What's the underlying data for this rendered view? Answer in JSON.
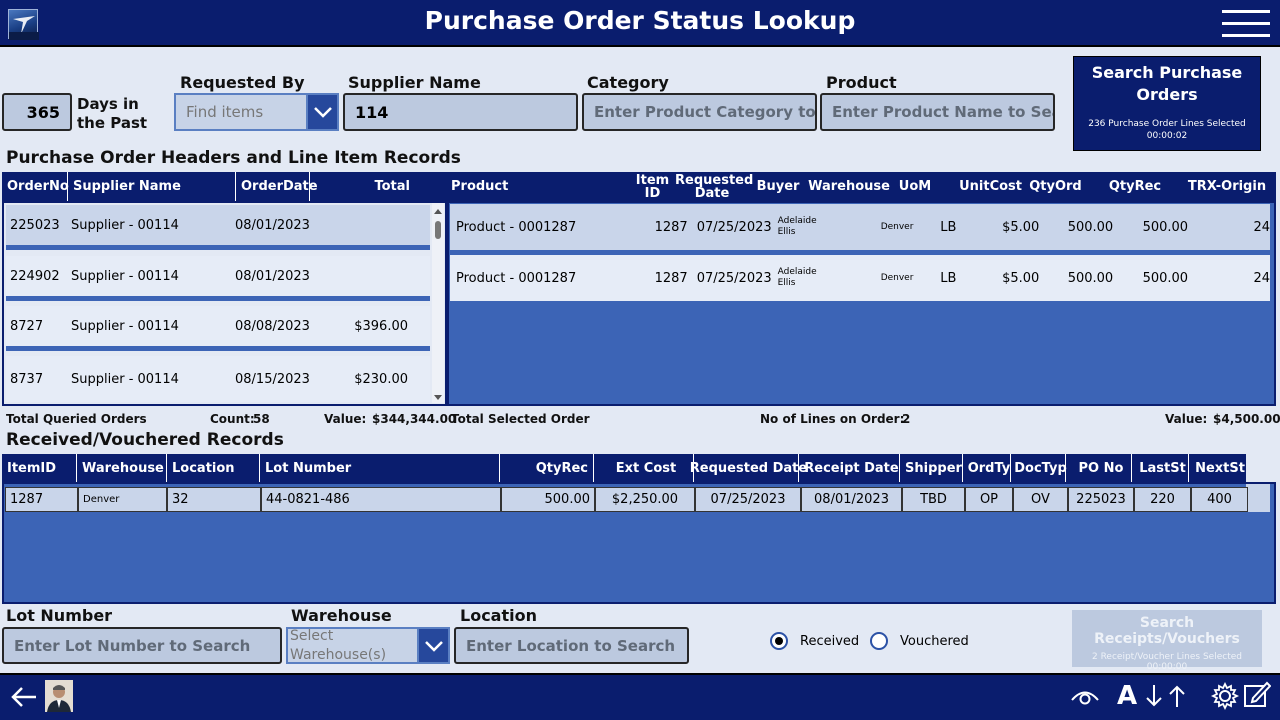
{
  "header": {
    "title": "Purchase Order Status Lookup"
  },
  "filters": {
    "days_value": "365",
    "days_label": "Days in the Past",
    "requested_by_label": "Requested By",
    "requested_by_placeholder": "Find items",
    "supplier_label": "Supplier Name",
    "supplier_value": "114",
    "category_label": "Category",
    "category_placeholder": "Enter Product Category to S",
    "product_label": "Product",
    "product_placeholder": "Enter Product Name to Sea"
  },
  "search_po": {
    "label": "Search Purchase Orders",
    "status": "236 Purchase Order Lines Selected",
    "time": "00:00:02"
  },
  "po_section_title": "Purchase Order Headers and Line Item Records",
  "po_headers": {
    "columns": [
      "OrderNo",
      "Supplier Name",
      "OrderDate",
      "Total"
    ],
    "rows": [
      {
        "order_no": "225023",
        "supplier": "Supplier - 00114",
        "date": "08/01/2023",
        "total": ""
      },
      {
        "order_no": "224902",
        "supplier": "Supplier - 00114",
        "date": "08/01/2023",
        "total": ""
      },
      {
        "order_no": "8727",
        "supplier": "Supplier - 00114",
        "date": "08/08/2023",
        "total": "$396.00"
      },
      {
        "order_no": "8737",
        "supplier": "Supplier - 00114",
        "date": "08/15/2023",
        "total": "$230.00"
      }
    ]
  },
  "line_items": {
    "columns": [
      "Product",
      "Item ID",
      "Requested Date",
      "Buyer",
      "Warehouse",
      "UoM",
      "UnitCost",
      "QtyOrd",
      "QtyRec",
      "TRX-Origin"
    ],
    "rows": [
      {
        "product": "Product - 0001287",
        "item_id": "1287",
        "req_date": "07/25/2023",
        "buyer_first": "Adelaide",
        "buyer_last": "Ellis",
        "warehouse": "Denver",
        "uom": "LB",
        "unit_cost": "$5.00",
        "qty_ord": "500.00",
        "qty_rec": "500.00",
        "trx_origin": "24"
      },
      {
        "product": "Product - 0001287",
        "item_id": "1287",
        "req_date": "07/25/2023",
        "buyer_first": "Adelaide",
        "buyer_last": "Ellis",
        "warehouse": "Denver",
        "uom": "LB",
        "unit_cost": "$5.00",
        "qty_ord": "500.00",
        "qty_rec": "500.00",
        "trx_origin": "24"
      }
    ]
  },
  "totals": {
    "queried_label": "Total Queried Orders",
    "count_label": "Count:",
    "count_value": "58",
    "value_label": "Value:",
    "value_amount": "$344,344.00",
    "selected_label": "Total Selected Order",
    "lines_label": "No of Lines on Order:",
    "lines_value": "2",
    "selected_value_label": "Value:",
    "selected_value_amount": "$4,500.00"
  },
  "received_section_title": "Received/Vouchered Records",
  "received": {
    "columns": [
      "ItemID",
      "Warehouse",
      "Location",
      "Lot Number",
      "QtyRec",
      "Ext Cost",
      "Requested Date",
      "Receipt Date",
      "Shipper",
      "OrdTy",
      "DocTyp",
      "PO No",
      "LastSt",
      "NextSt"
    ],
    "rows": [
      {
        "item_id": "1287",
        "warehouse": "Denver",
        "location": "32",
        "lot": "44-0821-486",
        "qty_rec": "500.00",
        "ext_cost": "$2,250.00",
        "req_date": "07/25/2023",
        "receipt_date": "08/01/2023",
        "shipper": "TBD",
        "ord_ty": "OP",
        "doc_typ": "OV",
        "po_no": "225023",
        "last_st": "220",
        "next_st": "400"
      }
    ]
  },
  "bottom_filters": {
    "lot_label": "Lot Number",
    "lot_placeholder": "Enter Lot Number to Search",
    "warehouse_label": "Warehouse",
    "warehouse_placeholder": "Select Warehouse(s)",
    "location_label": "Location",
    "location_placeholder": "Enter Location to Search",
    "radio_received": "Received",
    "radio_vouchered": "Vouchered"
  },
  "search_receipts": {
    "label": "Search Receipts/Vouchers",
    "status": "2 Receipt/Voucher Lines Selected",
    "time": "00:00:00"
  },
  "colors": {
    "navy": "#0a1d6e",
    "blue": "#3c64b6",
    "bg": "#e3e9f4"
  }
}
